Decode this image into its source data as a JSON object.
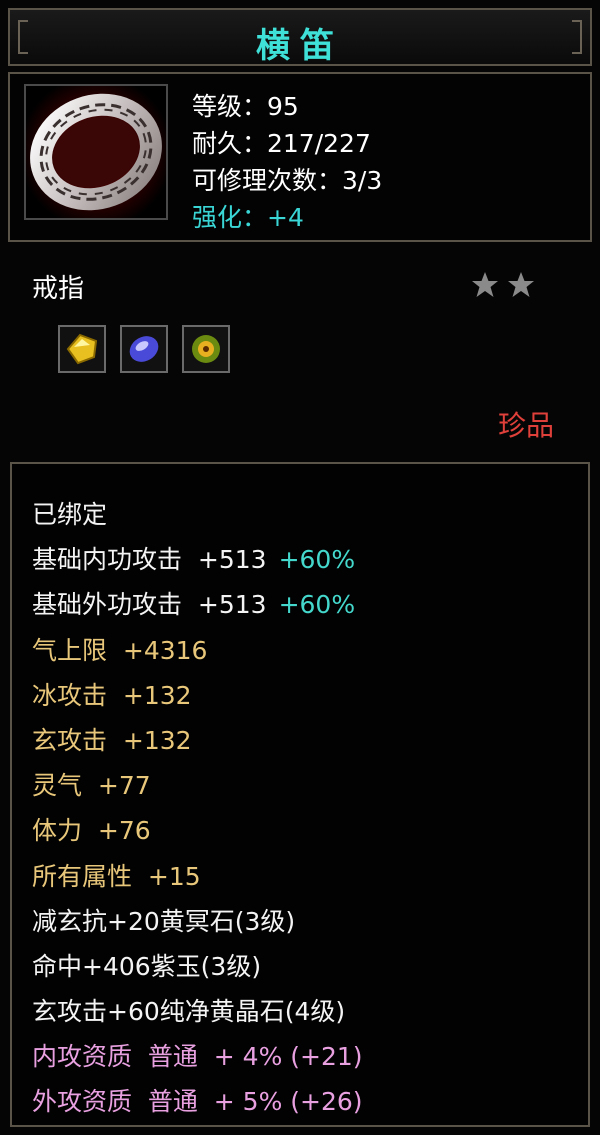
{
  "item": {
    "name": "横笛",
    "level_label": "等级：95",
    "durability_label": "耐久：217/227",
    "repair_label": "可修理次数：3/3",
    "enhance_label": "强化：+4",
    "category": "戒指",
    "rarity": "珍品",
    "stars": 2,
    "gems": [
      "yellow-gem",
      "purple-gem",
      "green-gem"
    ]
  },
  "stats": {
    "bound": "已绑定",
    "lines": [
      {
        "label": "基础内功攻击  +513",
        "extra": "+60%",
        "color": "white"
      },
      {
        "label": "基础外功攻击  +513",
        "extra": "+60%",
        "color": "white"
      },
      {
        "label": "气上限  +4316",
        "extra": "",
        "color": "gold"
      },
      {
        "label": "冰攻击  +132",
        "extra": "",
        "color": "gold"
      },
      {
        "label": "玄攻击  +132",
        "extra": "",
        "color": "gold"
      },
      {
        "label": "灵气  +77",
        "extra": "",
        "color": "gold"
      },
      {
        "label": "体力  +76",
        "extra": "",
        "color": "gold"
      },
      {
        "label": "所有属性  +15",
        "extra": "",
        "color": "gold"
      },
      {
        "label": "减玄抗+20黄冥石(3级)",
        "extra": "",
        "color": "white"
      },
      {
        "label": "命中+406紫玉(3级)",
        "extra": "",
        "color": "white"
      },
      {
        "label": "玄攻击+60纯净黄晶石(4级)",
        "extra": "",
        "color": "white"
      },
      {
        "label": "内攻资质  普通  + 4% (+21)",
        "extra": "",
        "color": "pink"
      },
      {
        "label": "外攻资质  普通  + 5% (+26)",
        "extra": "",
        "color": "pink"
      }
    ]
  },
  "colors": {
    "title": "#3fe0d8",
    "enhance": "#3ad6d6",
    "rarity": "#e0403a",
    "gold": "#e8c77a",
    "pink": "#e8a0e0",
    "percent": "#44d8cc"
  }
}
